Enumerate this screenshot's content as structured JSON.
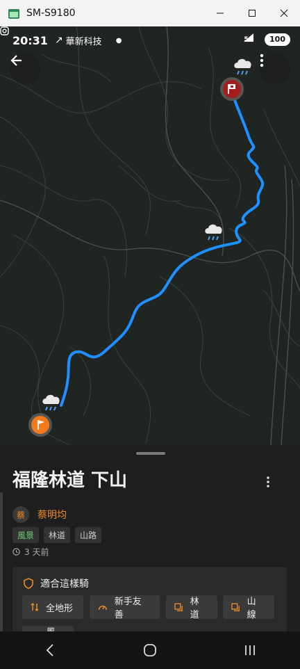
{
  "window": {
    "title": "SM-S9180"
  },
  "statusbar": {
    "time": "20:31",
    "news_label": "華新科技",
    "network": "5G",
    "battery": "100"
  },
  "map": {
    "icons": [
      "back-arrow-icon",
      "more-vertical-icon",
      "rain-cloud-icon",
      "finish-flag-icon",
      "start-flag-icon"
    ],
    "route_color": "#1e90ff"
  },
  "trail": {
    "title": "福隆林道 下山",
    "author_initial": "蔡",
    "author_name": "蔡明均",
    "tags": [
      {
        "label": "風景",
        "color": "#6fcf70"
      },
      {
        "label": "林道",
        "color": "#cccccc"
      },
      {
        "label": "山路",
        "color": "#cccccc"
      }
    ],
    "time_ago": "3 天前"
  },
  "suitability": {
    "header": "適合這樣騎",
    "chips": [
      "全地形",
      "新手友善",
      "林道",
      "山線",
      "風景"
    ]
  },
  "colors": {
    "accent": "#f08a24",
    "danger": "#a31d1d"
  }
}
